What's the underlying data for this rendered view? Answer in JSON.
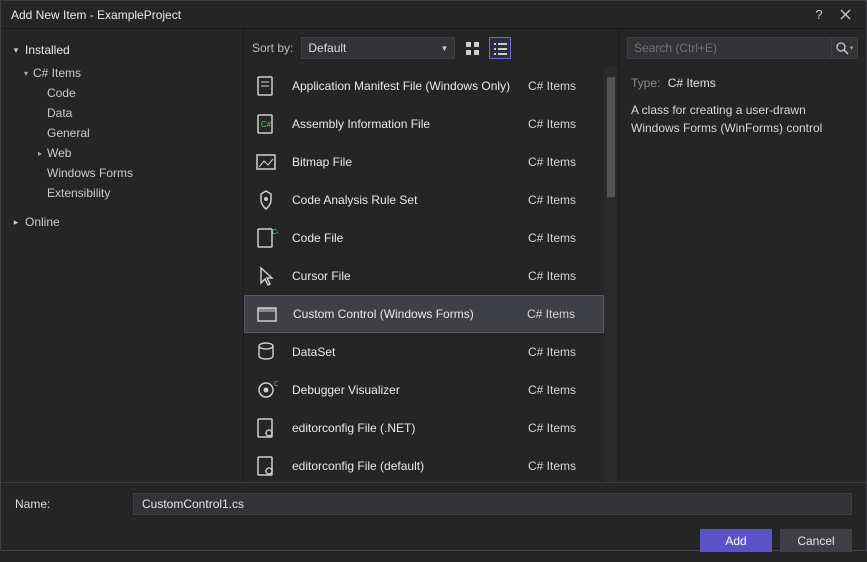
{
  "window": {
    "title": "Add New Item - ExampleProject"
  },
  "left": {
    "installed": "Installed",
    "csharp": "C# Items",
    "children": [
      "Code",
      "Data",
      "General",
      "Web",
      "Windows Forms",
      "Extensibility"
    ],
    "online": "Online"
  },
  "toolbar": {
    "sortby_label": "Sort by:",
    "sort_value": "Default"
  },
  "templates": [
    {
      "name": "Application Manifest File (Windows Only)",
      "category": "C# Items",
      "icon": "manifest"
    },
    {
      "name": "Assembly Information File",
      "category": "C# Items",
      "icon": "assembly"
    },
    {
      "name": "Bitmap File",
      "category": "C# Items",
      "icon": "bitmap"
    },
    {
      "name": "Code Analysis Rule Set",
      "category": "C# Items",
      "icon": "ruleset"
    },
    {
      "name": "Code File",
      "category": "C# Items",
      "icon": "codefile"
    },
    {
      "name": "Cursor File",
      "category": "C# Items",
      "icon": "cursor"
    },
    {
      "name": "Custom Control (Windows Forms)",
      "category": "C# Items",
      "icon": "customcontrol",
      "selected": true
    },
    {
      "name": "DataSet",
      "category": "C# Items",
      "icon": "dataset"
    },
    {
      "name": "Debugger Visualizer",
      "category": "C# Items",
      "icon": "debugvis"
    },
    {
      "name": "editorconfig File (.NET)",
      "category": "C# Items",
      "icon": "editorconfig"
    },
    {
      "name": "editorconfig File (default)",
      "category": "C# Items",
      "icon": "editorconfig"
    }
  ],
  "search": {
    "placeholder": "Search (Ctrl+E)"
  },
  "description": {
    "type_label": "Type:",
    "type_value": "C# Items",
    "text": "A class for creating a user-drawn Windows Forms (WinForms) control"
  },
  "footer": {
    "name_label": "Name:",
    "name_value": "CustomControl1.cs",
    "add": "Add",
    "cancel": "Cancel"
  }
}
